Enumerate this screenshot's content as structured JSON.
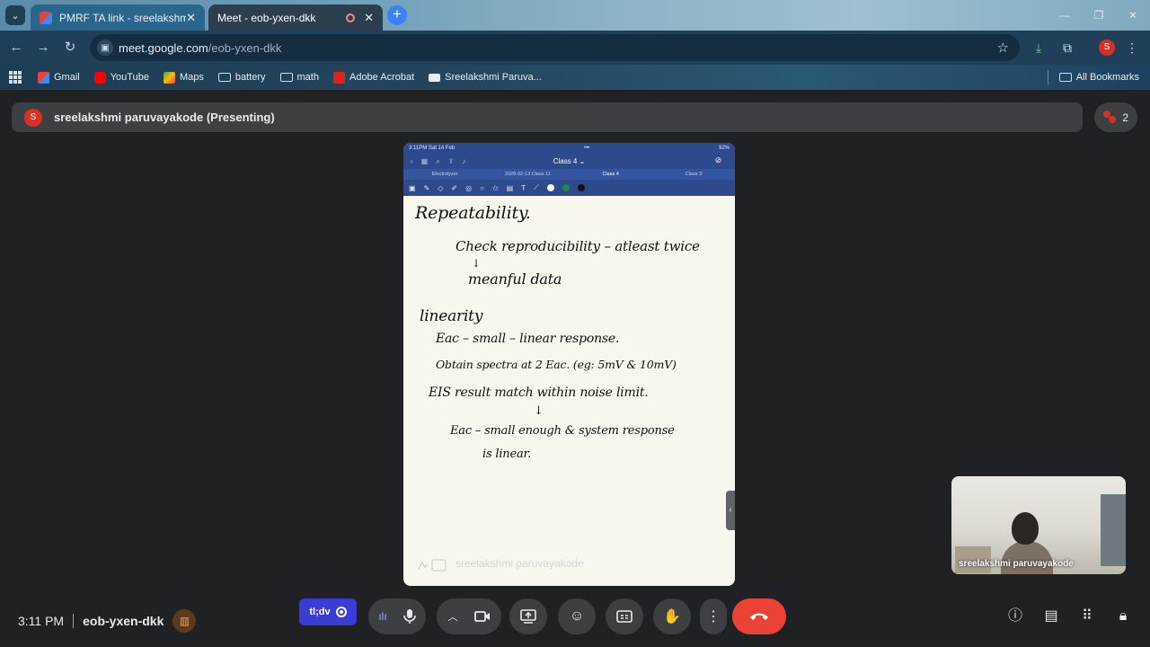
{
  "browser": {
    "tabs": [
      {
        "title": "PMRF TA link - sreelakshmiparu",
        "active": false
      },
      {
        "title": "Meet - eob-yxen-dkk",
        "active": true
      }
    ],
    "url_host": "meet.google.com",
    "url_path": "/eob-yxen-dkk",
    "profile_initial": "S"
  },
  "bookmarks": {
    "items": [
      {
        "label": "Gmail",
        "icon": "gmail-icon"
      },
      {
        "label": "YouTube",
        "icon": "youtube-icon"
      },
      {
        "label": "Maps",
        "icon": "maps-icon"
      },
      {
        "label": "battery",
        "icon": "folder-icon"
      },
      {
        "label": "math",
        "icon": "folder-icon"
      },
      {
        "label": "Adobe Acrobat",
        "icon": "acrobat-icon"
      },
      {
        "label": "Sreelakshmi Paruva...",
        "icon": "page-icon"
      }
    ],
    "all_bookmarks": "All Bookmarks"
  },
  "meet": {
    "presenter_initial": "S",
    "presenter_banner": "sreelakshmi paruvayakode (Presenting)",
    "participant_count": "2",
    "share": {
      "status_left": "3:11PM   Sat 14 Feb",
      "status_dots": "•••",
      "status_right": "92%",
      "notebook_title": "Class 4 ⌄",
      "tabs": [
        "Electrolyzer",
        "2026-02-13 Class 11",
        "Class 4",
        "Class 3"
      ],
      "active_tab": 2,
      "handwriting": [
        "Repeatability.",
        "Check reproducibility – atleast twice",
        "↓",
        "meanful data",
        "linearity",
        "Eac – small – linear response.",
        "Obtain spectra at 2 Eac. (eg: 5mV & 10mV)",
        "EIS result match within noise limit.",
        "↓",
        "Eac – small enough & system response",
        "is linear."
      ],
      "caption": "sreelakshmi paruvayakode"
    },
    "selfview_name": "sreelakshmi paruvayakode",
    "time": "3:11 PM",
    "meeting_code": "eob-yxen-dkk",
    "tldv_label": "tl;dv"
  }
}
